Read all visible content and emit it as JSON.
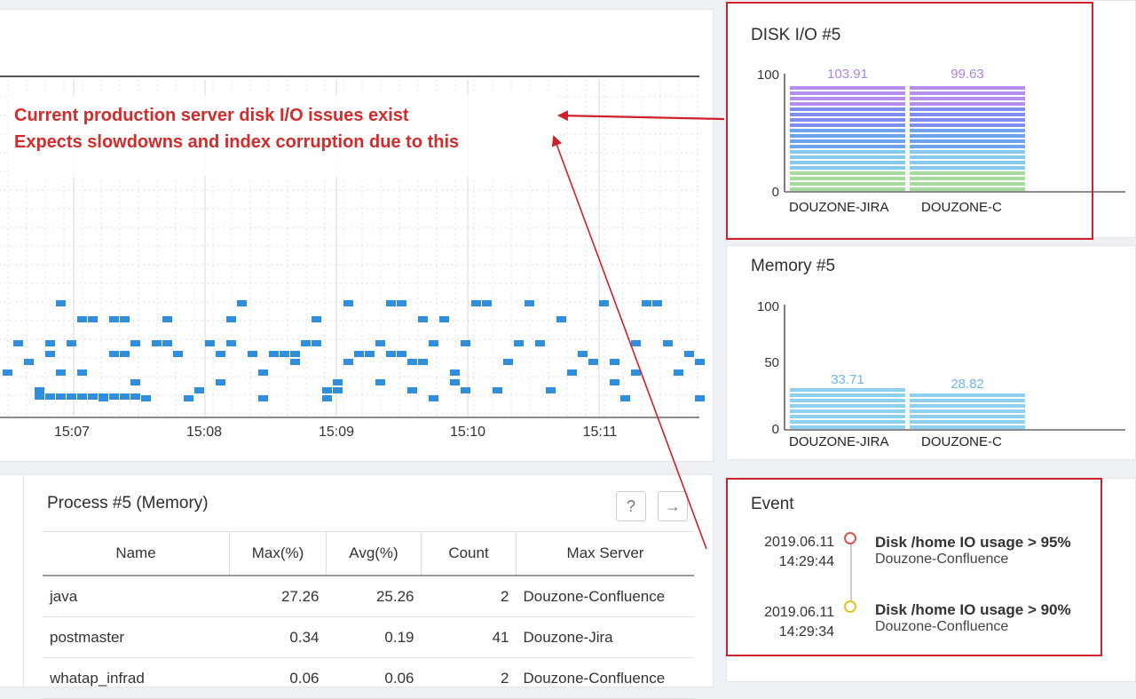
{
  "annotation": {
    "line1": "Current production server disk I/O issues exist",
    "line2": "Expects slowdowns and index corruption due to this"
  },
  "timeline": {
    "x_labels": [
      "15:07",
      "15:08",
      "15:09",
      "15:10",
      "15:11"
    ]
  },
  "disk_io": {
    "title": "DISK I/O #5",
    "y_ticks": [
      "100",
      "0"
    ],
    "colors": [
      "#b58ff0",
      "#7f8cf0",
      "#6fa3ef",
      "#86c9ef",
      "#a4dc9b"
    ]
  },
  "memory": {
    "title": "Memory #5",
    "y_ticks": [
      "100",
      "50",
      "0"
    ],
    "colors": [
      "#8ed0f0",
      "#a4dc9b"
    ]
  },
  "chart_data": [
    {
      "type": "bar",
      "title": "DISK I/O #5",
      "categories": [
        "DOUZONE-JIRA",
        "DOUZONE-C"
      ],
      "values": [
        103.91,
        99.63
      ],
      "value_labels": [
        "103.91",
        "99.63"
      ],
      "ylim": [
        0,
        100
      ],
      "grid": false
    },
    {
      "type": "bar",
      "title": "Memory #5",
      "categories": [
        "DOUZONE-JIRA",
        "DOUZONE-C"
      ],
      "values": [
        33.71,
        28.82
      ],
      "value_labels": [
        "33.71",
        "28.82"
      ],
      "ylim": [
        0,
        100
      ],
      "grid": false
    }
  ],
  "process": {
    "title": "Process #5 (Memory)",
    "help_icon": "question-icon",
    "nav_icon": "arrow-right-icon",
    "columns": [
      "Name",
      "Max(%)",
      "Avg(%)",
      "Count",
      "Max Server"
    ],
    "rows": [
      {
        "name": "java",
        "max": "27.26",
        "avg": "25.26",
        "count": "2",
        "server": "Douzone-Confluence"
      },
      {
        "name": "postmaster",
        "max": "0.34",
        "avg": "0.19",
        "count": "41",
        "server": "Douzone-Jira"
      },
      {
        "name": "whatap_infrad",
        "max": "0.06",
        "avg": "0.06",
        "count": "2",
        "server": "Douzone-Confluence"
      }
    ]
  },
  "event": {
    "title": "Event",
    "items": [
      {
        "date": "2019.06.11",
        "time": "14:29:44",
        "title": "Disk /home IO usage > 95%",
        "server": "Douzone-Confluence",
        "color": "#d9534f"
      },
      {
        "date": "2019.06.11",
        "time": "14:29:34",
        "title": "Disk /home IO usage > 90%",
        "server": "Douzone-Confluence",
        "color": "#e8c21e"
      }
    ]
  }
}
